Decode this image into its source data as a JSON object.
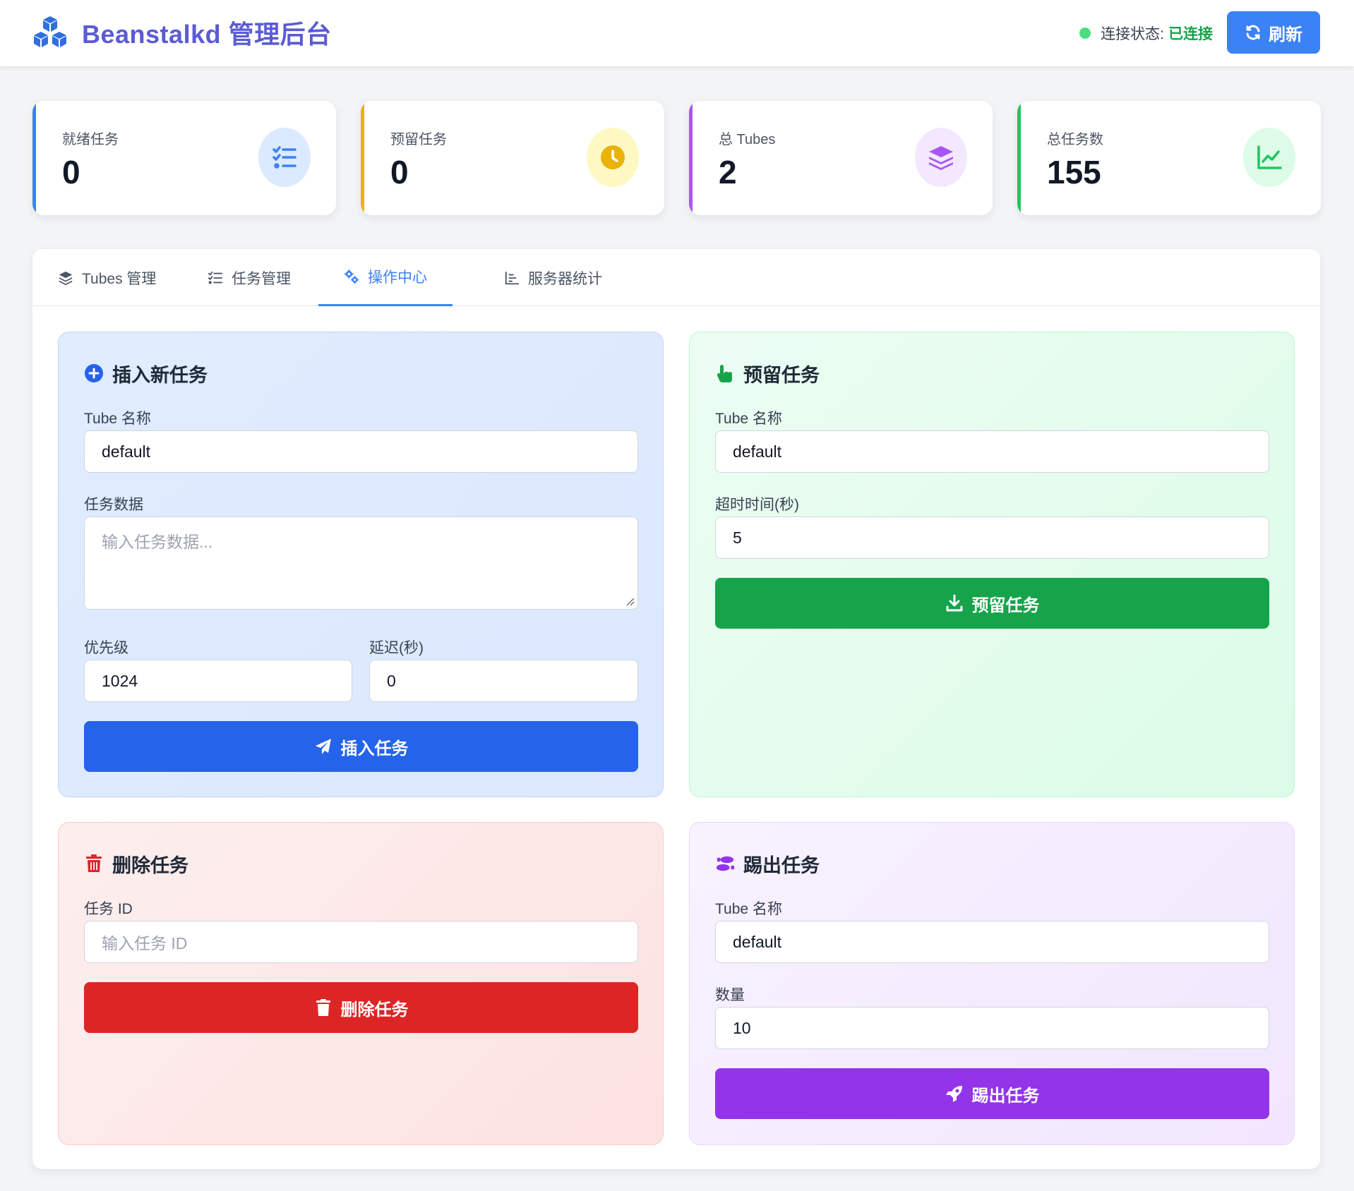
{
  "header": {
    "title": "Beanstalkd 管理后台",
    "connection_label": "连接状态:",
    "connection_value": "已连接",
    "refresh_label": "刷新"
  },
  "stats": [
    {
      "label": "就绪任务",
      "value": "0",
      "accent": "#3b82f6",
      "icon": "list-check-icon"
    },
    {
      "label": "预留任务",
      "value": "0",
      "accent": "#eab308",
      "icon": "clock-icon"
    },
    {
      "label": "总 Tubes",
      "value": "2",
      "accent": "#a855f7",
      "icon": "layers-icon"
    },
    {
      "label": "总任务数",
      "value": "155",
      "accent": "#22c55e",
      "icon": "chart-line-icon"
    }
  ],
  "tabs": [
    {
      "label": "Tubes 管理",
      "icon": "layers-icon"
    },
    {
      "label": "任务管理",
      "icon": "list-check-icon"
    },
    {
      "label": "操作中心",
      "icon": "gears-icon",
      "active": true
    },
    {
      "label": "服务器统计",
      "icon": "chart-bar-icon"
    }
  ],
  "insert": {
    "title": "插入新任务",
    "tube_label": "Tube 名称",
    "tube_value": "default",
    "data_label": "任务数据",
    "data_placeholder": "输入任务数据...",
    "priority_label": "优先级",
    "priority_value": "1024",
    "delay_label": "延迟(秒)",
    "delay_value": "0",
    "button": "插入任务"
  },
  "reserve": {
    "title": "预留任务",
    "tube_label": "Tube 名称",
    "tube_value": "default",
    "timeout_label": "超时时间(秒)",
    "timeout_value": "5",
    "button": "预留任务"
  },
  "delete": {
    "title": "删除任务",
    "id_label": "任务 ID",
    "id_placeholder": "输入任务 ID",
    "button": "删除任务"
  },
  "kick": {
    "title": "踢出任务",
    "tube_label": "Tube 名称",
    "tube_value": "default",
    "count_label": "数量",
    "count_value": "10",
    "button": "踢出任务"
  },
  "colors": {
    "brand": "#5b5bd6",
    "primary": "#2563eb",
    "success": "#16a34a",
    "danger": "#dc2626",
    "purple": "#9333ea"
  }
}
